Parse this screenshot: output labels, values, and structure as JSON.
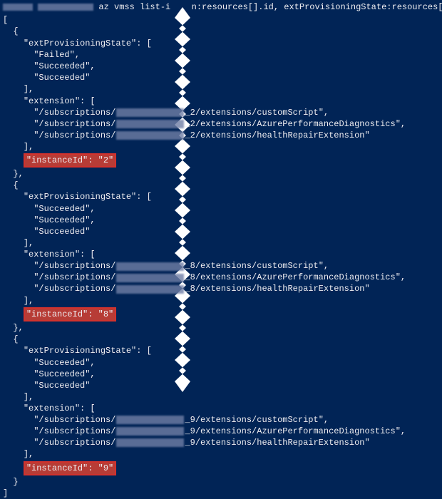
{
  "command": {
    "az_part": "az vmss list-i",
    "after_tear": "n:resources[].id, extProvisioningState:resources[]"
  },
  "path_prefix": "\"/subscriptions/",
  "instances": [
    {
      "id_suffix": "_2",
      "states": [
        "Failed",
        "Succeeded",
        "Succeeded"
      ],
      "ext_names": [
        "customScript",
        "AzurePerformanceDiagnostics",
        "healthRepairExtension"
      ],
      "instance_text": "\"instanceId\": \"2\""
    },
    {
      "id_suffix": "_8",
      "states": [
        "Succeeded",
        "Succeeded",
        "Succeeded"
      ],
      "ext_names": [
        "customScript",
        "AzurePerformanceDiagnostics",
        "healthRepairExtension"
      ],
      "instance_text": "\"instanceId\": \"8\""
    },
    {
      "id_suffix": "_9",
      "states": [
        "Succeeded",
        "Succeeded",
        "Succeeded"
      ],
      "ext_names": [
        "customScript",
        "AzurePerformanceDiagnostics",
        "healthRepairExtension"
      ],
      "instance_text": "\"instanceId\": \"9\""
    }
  ],
  "labels": {
    "ext_state": "\"extProvisioningState\": [",
    "extension": "\"extension\": [",
    "close_arr": "],",
    "obj_open": "{",
    "obj_close_comma": "},",
    "obj_close": "}",
    "arr_open": "[",
    "arr_close": "]",
    "ext_word": "/extensions/"
  }
}
